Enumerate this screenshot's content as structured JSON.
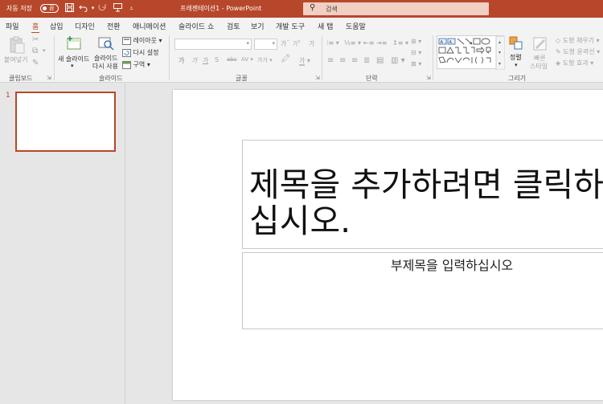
{
  "titlebar": {
    "autosave_label": "자동 저장",
    "autosave_state": "끔",
    "doc_title": "프레젠테이션1  -  PowerPoint",
    "search_placeholder": "검색",
    "accent_color": "#b7472a"
  },
  "tabs": [
    "파일",
    "홈",
    "삽입",
    "디자인",
    "전환",
    "애니메이션",
    "슬라이드 쇼",
    "검토",
    "보기",
    "개발 도구",
    "새 탭",
    "도움말"
  ],
  "active_tab": "홈",
  "ribbon": {
    "clipboard": {
      "paste": "붙여넣기",
      "label": "클립보드"
    },
    "slides": {
      "new_slide": "새 슬라이드",
      "reuse_slide_line1": "슬라이드",
      "reuse_slide_line2": "다시 사용",
      "layout": "레이아웃",
      "reset": "다시 설정",
      "section": "구역",
      "label": "슬라이드"
    },
    "font": {
      "label": "글꼴",
      "grow": "가",
      "shrink": "가",
      "bold": "가",
      "italic": "가",
      "underline": "가",
      "strike": "S",
      "spacing": "abc",
      "case": "가가",
      "clear": "가"
    },
    "paragraph": {
      "label": "단락"
    },
    "drawing": {
      "label": "그리기",
      "arrange": "정렬",
      "quick_styles_line1": "빠른",
      "quick_styles_line2": "스타일",
      "shape_fill": "도형 채우기",
      "shape_outline": "도형 윤곽선",
      "shape_effects": "도형 효과"
    }
  },
  "thumbnails": [
    {
      "number": "1"
    }
  ],
  "slide": {
    "title_placeholder": "제목을 추가하려면 클릭하\n십시오.",
    "subtitle_placeholder": "부제목을 입력하십시오"
  }
}
